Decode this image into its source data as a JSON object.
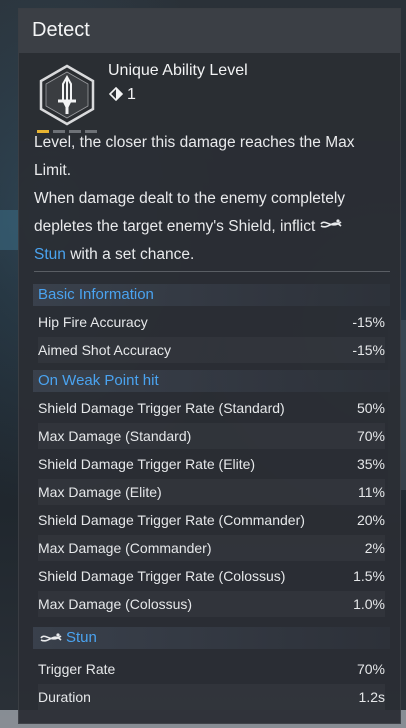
{
  "window": {
    "title": "Detect"
  },
  "ability": {
    "name": "Unique Ability Level",
    "level": "1",
    "level_dots": 4,
    "level_active": 1,
    "accent": "#e8b430"
  },
  "description": {
    "line1": "Level, the closer this damage reaches the Max",
    "line2": "Limit.",
    "line3": "When damage dealt to the enemy completely",
    "line4_pre": "depletes the target enemy's Shield, inflict",
    "stun_label": "Stun",
    "line5_post": "with a set chance."
  },
  "sections": {
    "basic": {
      "title": "Basic Information",
      "rows": [
        {
          "label": "Hip Fire Accuracy",
          "value": "-15%"
        },
        {
          "label": "Aimed Shot Accuracy",
          "value": "-15%"
        }
      ]
    },
    "weak": {
      "title": "On Weak Point hit",
      "rows": [
        {
          "label": "Shield Damage Trigger Rate (Standard)",
          "value": "50%"
        },
        {
          "label": "Max Damage (Standard)",
          "value": "70%"
        },
        {
          "label": "Shield Damage Trigger Rate (Elite)",
          "value": "35%"
        },
        {
          "label": "Max Damage (Elite)",
          "value": "11%"
        },
        {
          "label": "Shield Damage Trigger Rate (Commander)",
          "value": "20%"
        },
        {
          "label": "Max Damage (Commander)",
          "value": "2%"
        },
        {
          "label": "Shield Damage Trigger Rate (Colossus)",
          "value": "1.5%"
        },
        {
          "label": "Max Damage (Colossus)",
          "value": "1.0%"
        }
      ]
    },
    "stun": {
      "title": "Stun",
      "rows": [
        {
          "label": "Trigger Rate",
          "value": "70%"
        },
        {
          "label": "Duration",
          "value": "1.2s"
        }
      ]
    }
  },
  "colors": {
    "link": "#4aa3f0",
    "panel": "#2a2e34",
    "title_bar": "#3b3f45"
  }
}
